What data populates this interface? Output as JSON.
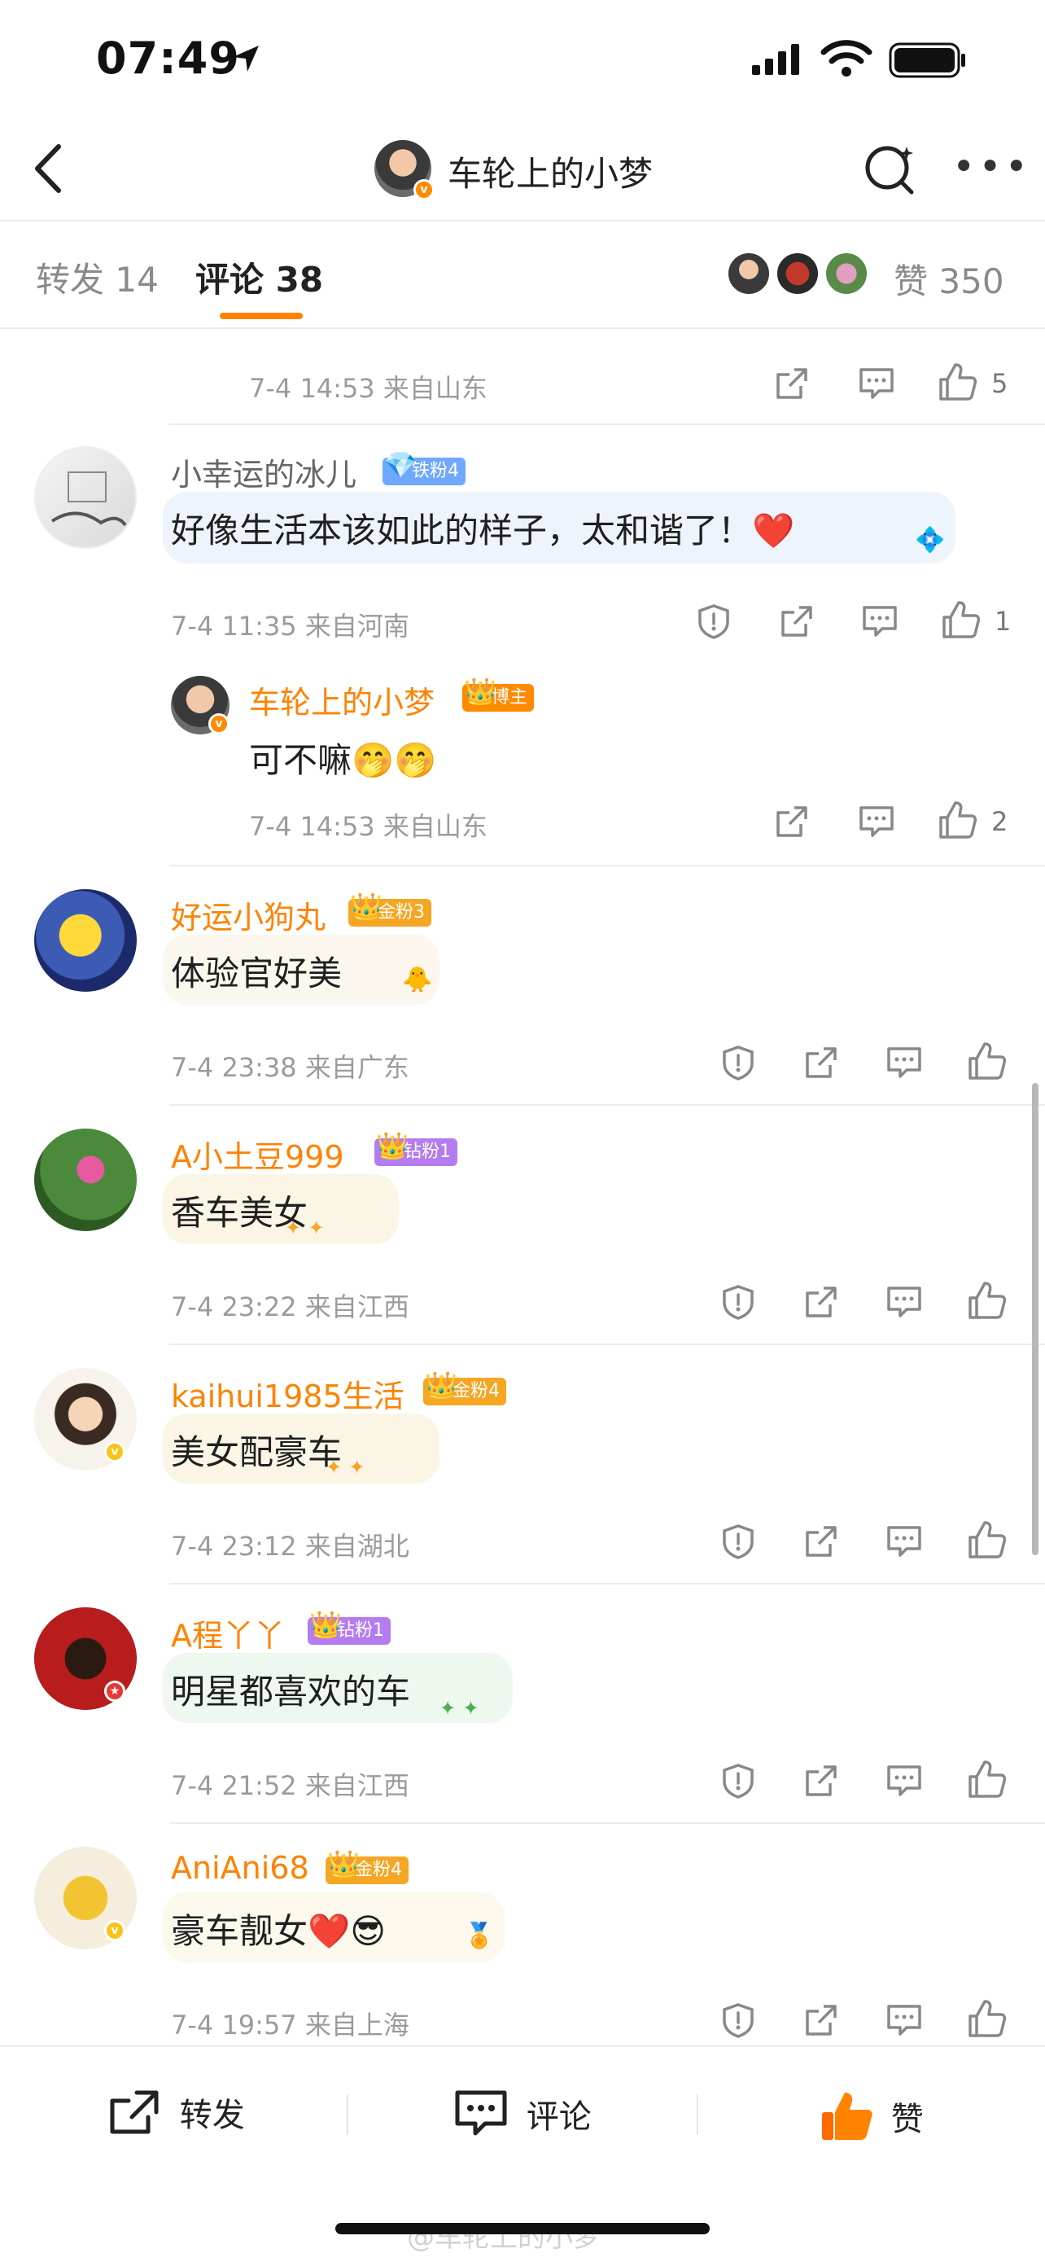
{
  "status_bar": {
    "time": "07:49"
  },
  "header": {
    "title": "车轮上的小梦"
  },
  "tabs": {
    "repost_label": "转发",
    "repost_count": "14",
    "comment_label": "评论",
    "comment_count": "38",
    "like_label": "赞",
    "like_count": "350"
  },
  "top_partial": {
    "meta": "7-4 14:53  来自山东",
    "like_count": "5"
  },
  "comments": [
    {
      "name": "小幸运的冰儿",
      "badge": "铁粉4",
      "text": "好像生活本该如此的样子，太和谐了！",
      "emoji": "❤️",
      "meta": "7-4 11:35  来自河南",
      "like_count": "1",
      "reply": {
        "name": "车轮上的小梦",
        "badge": "博主",
        "text": "可不嘛",
        "emoji": "🤭🤭",
        "meta": "7-4 14:53  来自山东",
        "like_count": "2"
      }
    },
    {
      "name": "好运小狗丸",
      "badge": "金粉3",
      "text": "体验官好美",
      "meta": "7-4 23:38  来自广东"
    },
    {
      "name": "A小土豆999",
      "badge": "钻粉1",
      "text": "香车美女",
      "meta": "7-4 23:22  来自江西"
    },
    {
      "name": "kaihui1985生活",
      "badge": "金粉4",
      "text": "美女配豪车",
      "meta": "7-4 23:12  来自湖北"
    },
    {
      "name": "A程丫丫",
      "badge": "钻粉1",
      "text": "明星都喜欢的车",
      "meta": "7-4 21:52  来自江西"
    },
    {
      "name": "AniAni68",
      "badge": "金粉4",
      "text": "豪车靓女",
      "emoji": "❤️😎",
      "meta": "7-4 19:57  来自上海"
    }
  ],
  "bottom_bar": {
    "repost": "转发",
    "comment": "评论",
    "like": "赞"
  },
  "watermark": "@车轮上的小梦",
  "colors": {
    "accent": "#ff8200",
    "vip_orange": "#ff8a00",
    "gold_badge": "#f5a623",
    "diamond_badge": "#b57cf0",
    "iron_badge": "#6fa8ff"
  }
}
